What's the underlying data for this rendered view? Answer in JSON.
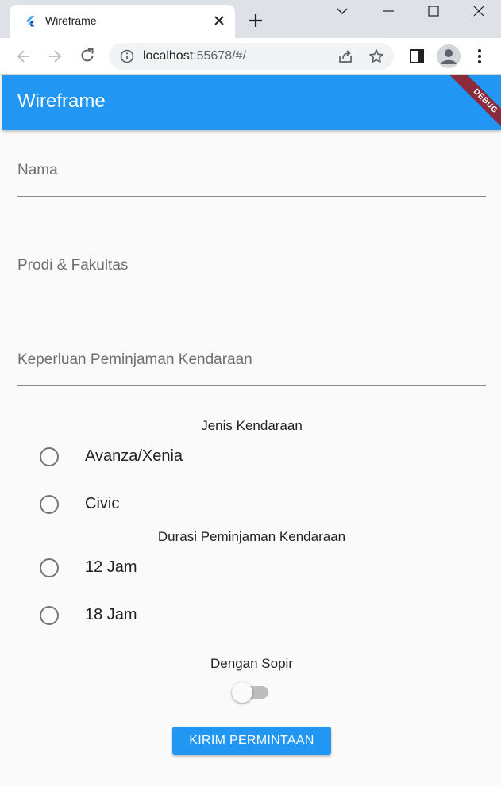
{
  "browser": {
    "tab_title": "Wireframe",
    "url_host": "localhost",
    "url_path": ":55678/#/"
  },
  "app": {
    "title": "Wireframe",
    "debug_label": "DEBUG",
    "accent_color": "#2196f3",
    "fields": [
      {
        "label": "Nama",
        "value": ""
      },
      {
        "label": "Prodi & Fakultas",
        "value": ""
      },
      {
        "label": "Keperluan Peminjaman Kendaraan",
        "value": ""
      }
    ],
    "vehicle_section": {
      "label": "Jenis Kendaraan",
      "options": [
        {
          "label": "Avanza/Xenia",
          "selected": false
        },
        {
          "label": "Civic",
          "selected": false
        }
      ]
    },
    "duration_section": {
      "label": "Durasi Peminjaman Kendaraan",
      "options": [
        {
          "label": "12 Jam",
          "selected": false
        },
        {
          "label": "18 Jam",
          "selected": false
        }
      ]
    },
    "driver_toggle": {
      "label": "Dengan Sopir",
      "on": false
    },
    "submit_label": "KIRIM PERMINTAAN"
  }
}
